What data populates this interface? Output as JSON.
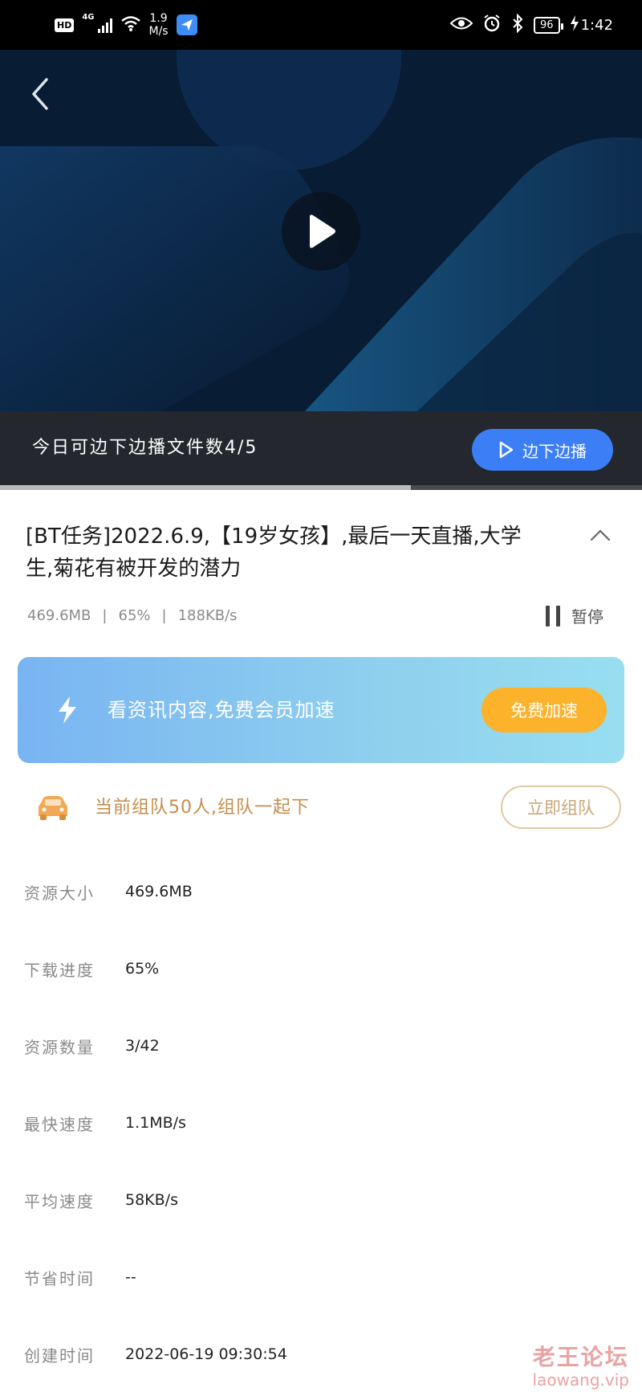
{
  "status_bar": {
    "hd": "HD",
    "network": "4G",
    "speed_value": "1.9",
    "speed_unit": "M/s",
    "battery": "96",
    "time": "1:42"
  },
  "player": {
    "promo_text": "今日可边下边播文件数4/5",
    "play_download_label": "边下边播",
    "progress_fraction": 0.64
  },
  "task": {
    "title": "[BT任务]2022.6.9,【19岁女孩】,最后一天直播,大学生,菊花有被开发的潜力",
    "size": "469.6MB",
    "percent": "65%",
    "speed": "188KB/s",
    "pause_label": "暂停"
  },
  "accelerate": {
    "text": "看资讯内容,免费会员加速",
    "button": "免费加速",
    "gradient_start": "#79b4f2",
    "gradient_end": "#98def0",
    "button_color": "#fdb22b"
  },
  "team": {
    "text": "当前组队50人,组队一起下",
    "button": "立即组队"
  },
  "details": [
    {
      "label": "资源大小",
      "value": "469.6MB"
    },
    {
      "label": "下载进度",
      "value": "65%"
    },
    {
      "label": "资源数量",
      "value": "3/42"
    },
    {
      "label": "最快速度",
      "value": "1.1MB/s"
    },
    {
      "label": "平均速度",
      "value": "58KB/s"
    },
    {
      "label": "节省时间",
      "value": "--"
    },
    {
      "label": "创建时间",
      "value": "2022-06-19 09:30:54"
    }
  ],
  "watermark": {
    "cn": "老王论坛",
    "en": "laowang.vip"
  }
}
